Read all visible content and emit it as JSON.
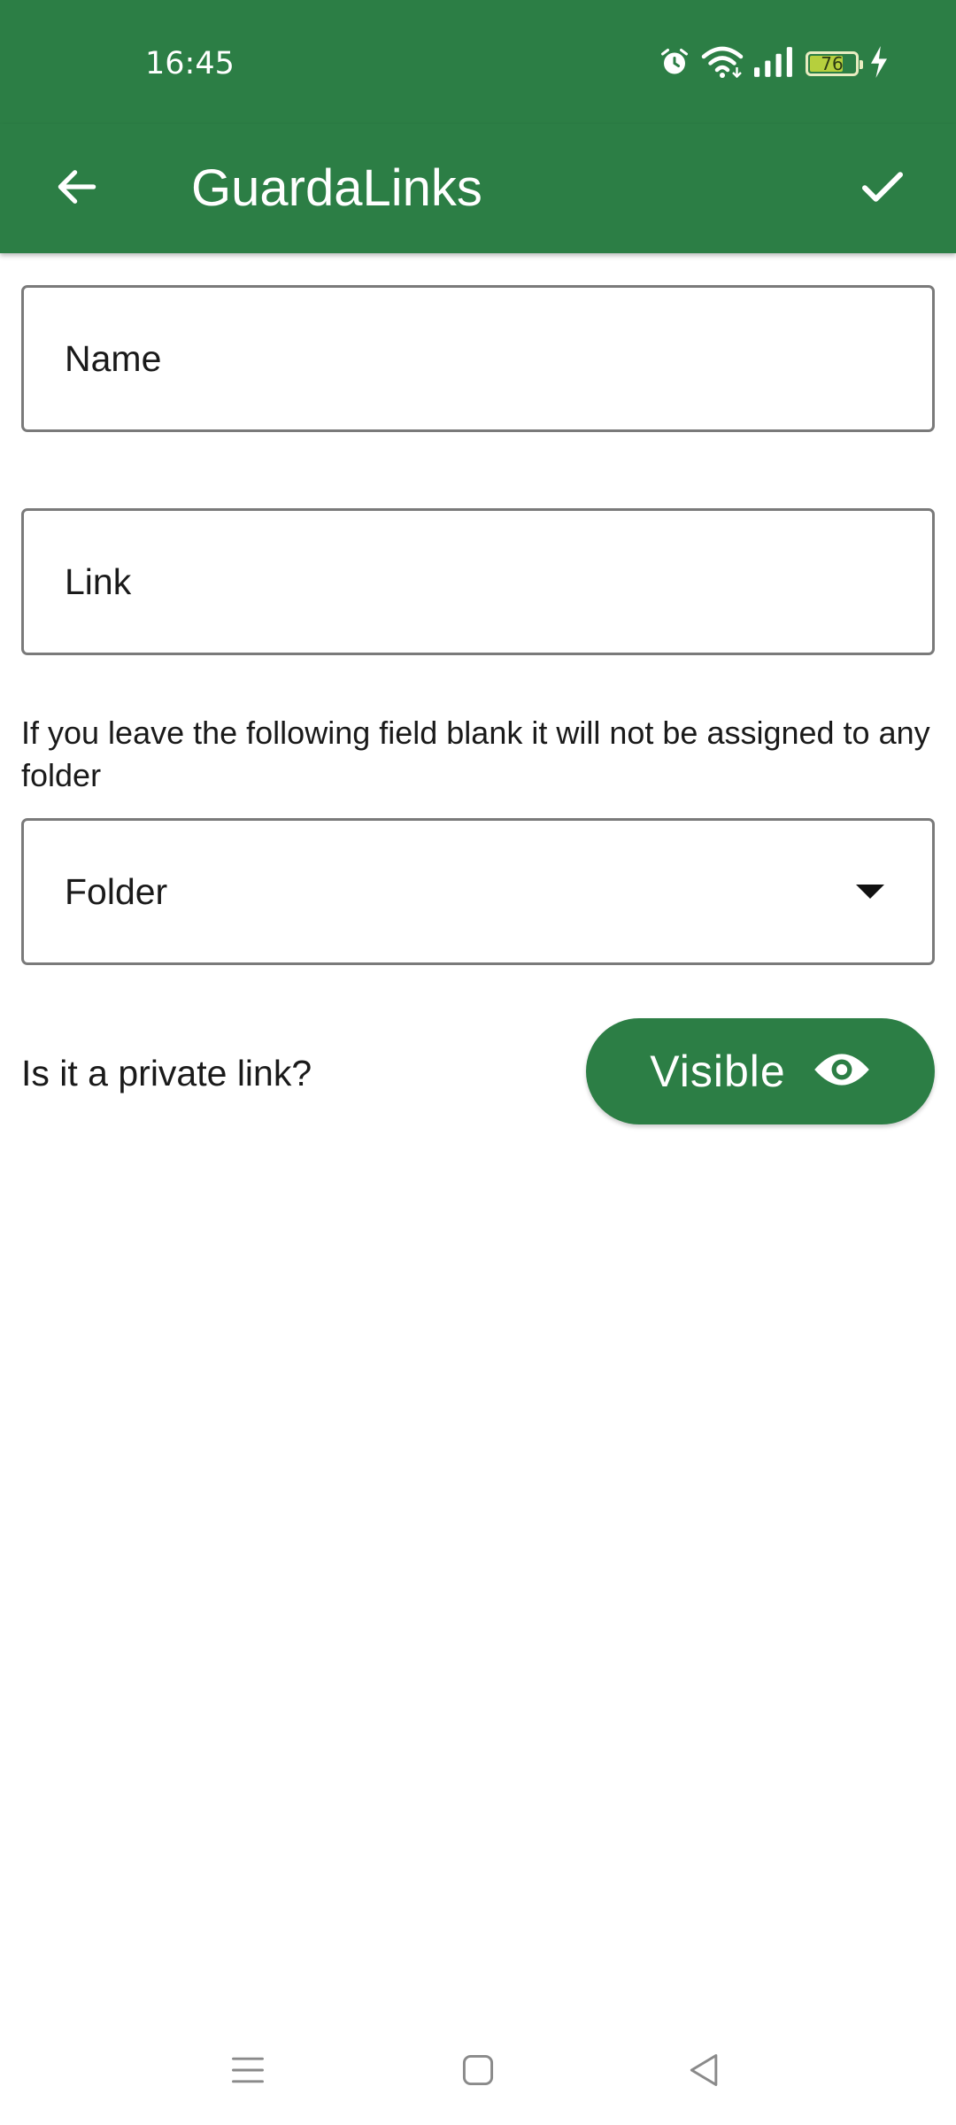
{
  "status_bar": {
    "time": "16:45",
    "battery_level": "76",
    "battery_fraction": 0.76,
    "icons": [
      "alarm-icon",
      "wifi-icon",
      "signal-icon",
      "battery-icon",
      "charging-icon"
    ]
  },
  "app_bar": {
    "title": "GuardaLinks",
    "back_icon": "arrow-back-icon",
    "confirm_icon": "check-icon"
  },
  "form": {
    "name_label": "Name",
    "link_label": "Link",
    "helper_text": "If you leave the following field blank it will not be assigned to any folder",
    "folder_label": "Folder",
    "private_question": "Is it a private link?",
    "visibility_button_label": "Visible",
    "visibility_icon": "eye-icon"
  },
  "nav_bar": {
    "items": [
      "menu-icon",
      "home-icon",
      "back-icon"
    ]
  },
  "colors": {
    "primary": "#2c7e45",
    "on_primary": "#ffffff",
    "outline": "#7a7a7a",
    "text": "#1a1a1a",
    "background": "#ffffff"
  }
}
